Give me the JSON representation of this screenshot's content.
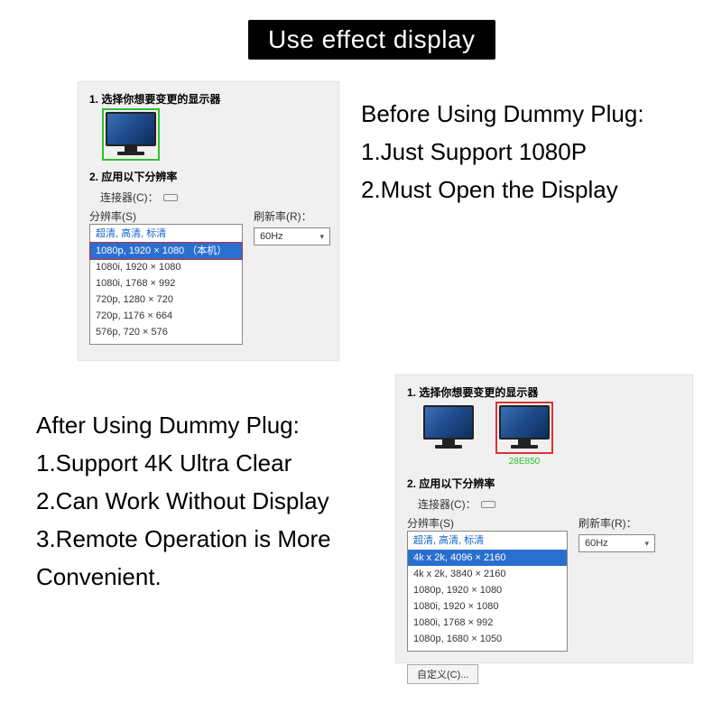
{
  "banner": "Use effect display",
  "before": {
    "title": "Before Using Dummy Plug:",
    "pt1": "1.Just Support 1080P",
    "pt2": "2.Must Open the Display",
    "panel": {
      "step1": "1.  选择你想要变更的显示器",
      "step2": "2.  应用以下分辨率",
      "connector_label": "连接器(C)：",
      "res_label": "分辨率(S)",
      "refresh_label": "刷新率(R)：",
      "refresh_value": "60Hz",
      "list_header": "超清, 高清, 标清",
      "selected": "1080p, 1920 × 1080 （本机）",
      "items": [
        "1080i, 1920 × 1080",
        "1080i, 1768 × 992",
        "720p, 1280 × 720",
        "720p, 1176 × 664",
        "576p, 720 × 576"
      ]
    }
  },
  "after": {
    "title": "After Using Dummy Plug:",
    "pt1": "1.Support 4K Ultra Clear",
    "pt2": "2.Can Work Without Display",
    "pt3": "3.Remote Operation is More Convenient.",
    "panel": {
      "step1": "1.  选择你想要变更的显示器",
      "step2": "2.  应用以下分辨率",
      "mon2_label": "28E850",
      "connector_label": "连接器(C)：",
      "res_label": "分辨率(S)",
      "refresh_label": "刷新率(R)：",
      "refresh_value": "60Hz",
      "list_header": "超清, 高清, 标清",
      "selected": "4k x 2k, 4096 × 2160",
      "items": [
        "4k x 2k, 3840 × 2160",
        "1080p, 1920 × 1080",
        "1080i, 1920 × 1080",
        "1080i, 1768 × 992",
        "1080p, 1680 × 1050"
      ],
      "custom_btn": "自定义(C)..."
    }
  }
}
